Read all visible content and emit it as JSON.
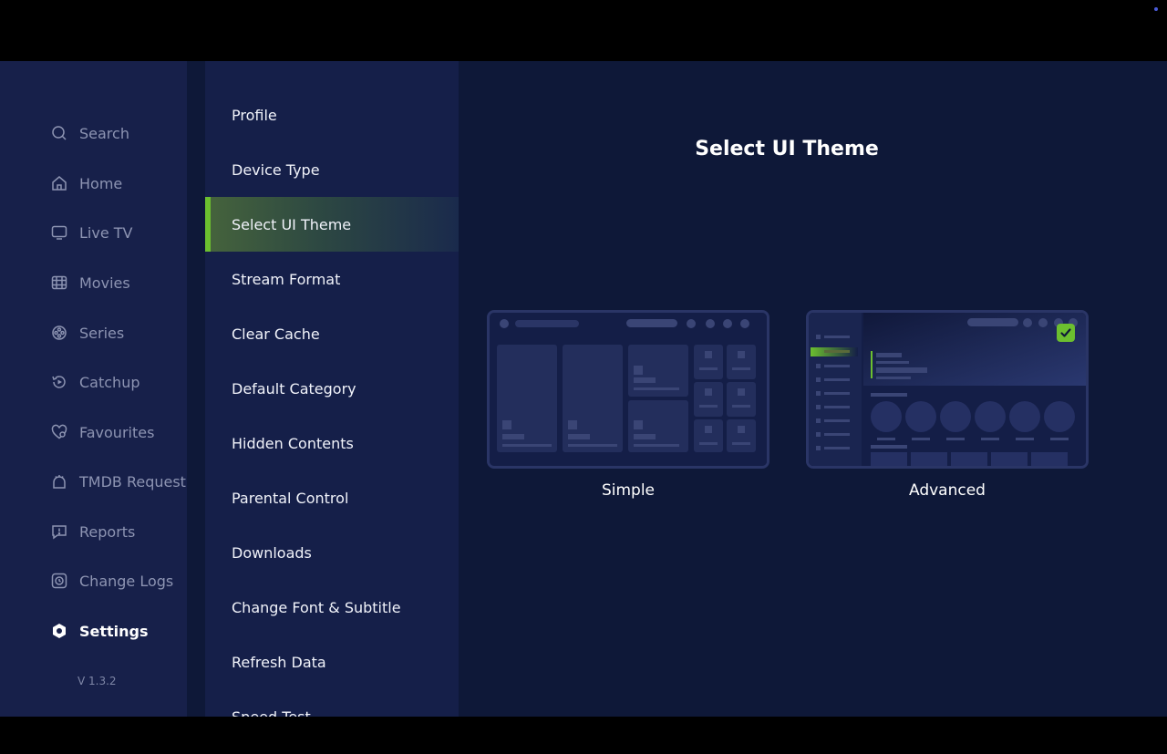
{
  "nav": {
    "items": [
      {
        "label": "Search",
        "icon": "search-icon"
      },
      {
        "label": "Home",
        "icon": "home-icon"
      },
      {
        "label": "Live TV",
        "icon": "tv-icon"
      },
      {
        "label": "Movies",
        "icon": "movie-icon"
      },
      {
        "label": "Series",
        "icon": "series-icon"
      },
      {
        "label": "Catchup",
        "icon": "catchup-icon"
      },
      {
        "label": "Favourites",
        "icon": "heart-icon"
      },
      {
        "label": "TMDB Request",
        "icon": "request-icon"
      },
      {
        "label": "Reports",
        "icon": "report-icon"
      },
      {
        "label": "Change Logs",
        "icon": "log-icon"
      },
      {
        "label": "Settings",
        "icon": "gear-icon",
        "active": true
      }
    ],
    "version": "V 1.3.2"
  },
  "settings_menu": {
    "items": [
      {
        "label": "Profile"
      },
      {
        "label": "Device Type"
      },
      {
        "label": "Select UI Theme",
        "active": true
      },
      {
        "label": "Stream Format"
      },
      {
        "label": "Clear Cache"
      },
      {
        "label": "Default Category"
      },
      {
        "label": "Hidden Contents"
      },
      {
        "label": "Parental Control"
      },
      {
        "label": "Downloads"
      },
      {
        "label": "Change Font & Subtitle"
      },
      {
        "label": "Refresh Data"
      },
      {
        "label": "Speed Test"
      }
    ]
  },
  "content": {
    "title": "Select UI Theme",
    "themes": [
      {
        "label": "Simple",
        "selected": false
      },
      {
        "label": "Advanced",
        "selected": true
      }
    ]
  },
  "colors": {
    "accent": "#6cbf2f",
    "background": "#0e1838",
    "nav_bg": "#17204a",
    "menu_bg": "#151f49"
  }
}
